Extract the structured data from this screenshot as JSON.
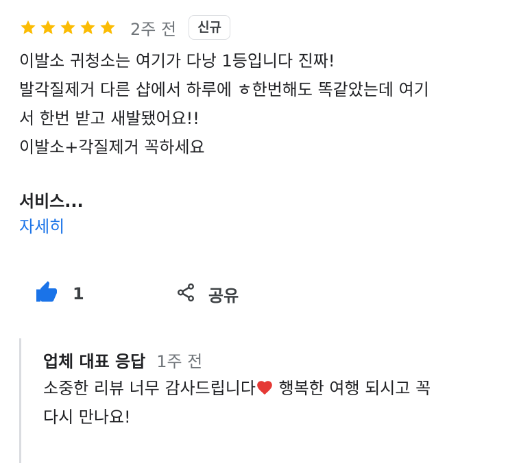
{
  "review": {
    "rating": 5,
    "star_color": "#fbbc04",
    "time": "2주 전",
    "badge": "신규",
    "text_lines": [
      "이발소 귀청소는 여기가 다낭 1등입니다 진짜!",
      "발각질제거 다른 샵에서 하루에 ㅎ한번해도 똑같았는데 여기",
      "서 한번 받고 새발됐어요!!",
      "이발소+각질제거 꼭하세요"
    ],
    "service_label": "서비스...",
    "more_link": "자세히"
  },
  "actions": {
    "like_count": "1",
    "like_icon": "thumbs-up-icon",
    "share_label": "공유",
    "share_icon": "share-icon",
    "accent_color": "#1a73e8"
  },
  "owner_response": {
    "title": "업체 대표 응답",
    "time": "1주 전",
    "line1_before_emoji": "소중한 리뷰 너무 감사드립니다",
    "emoji": "red-heart-icon",
    "line1_after_emoji": " 행복한 여행 되시고 꼭",
    "line2": "다시 만나요!"
  }
}
